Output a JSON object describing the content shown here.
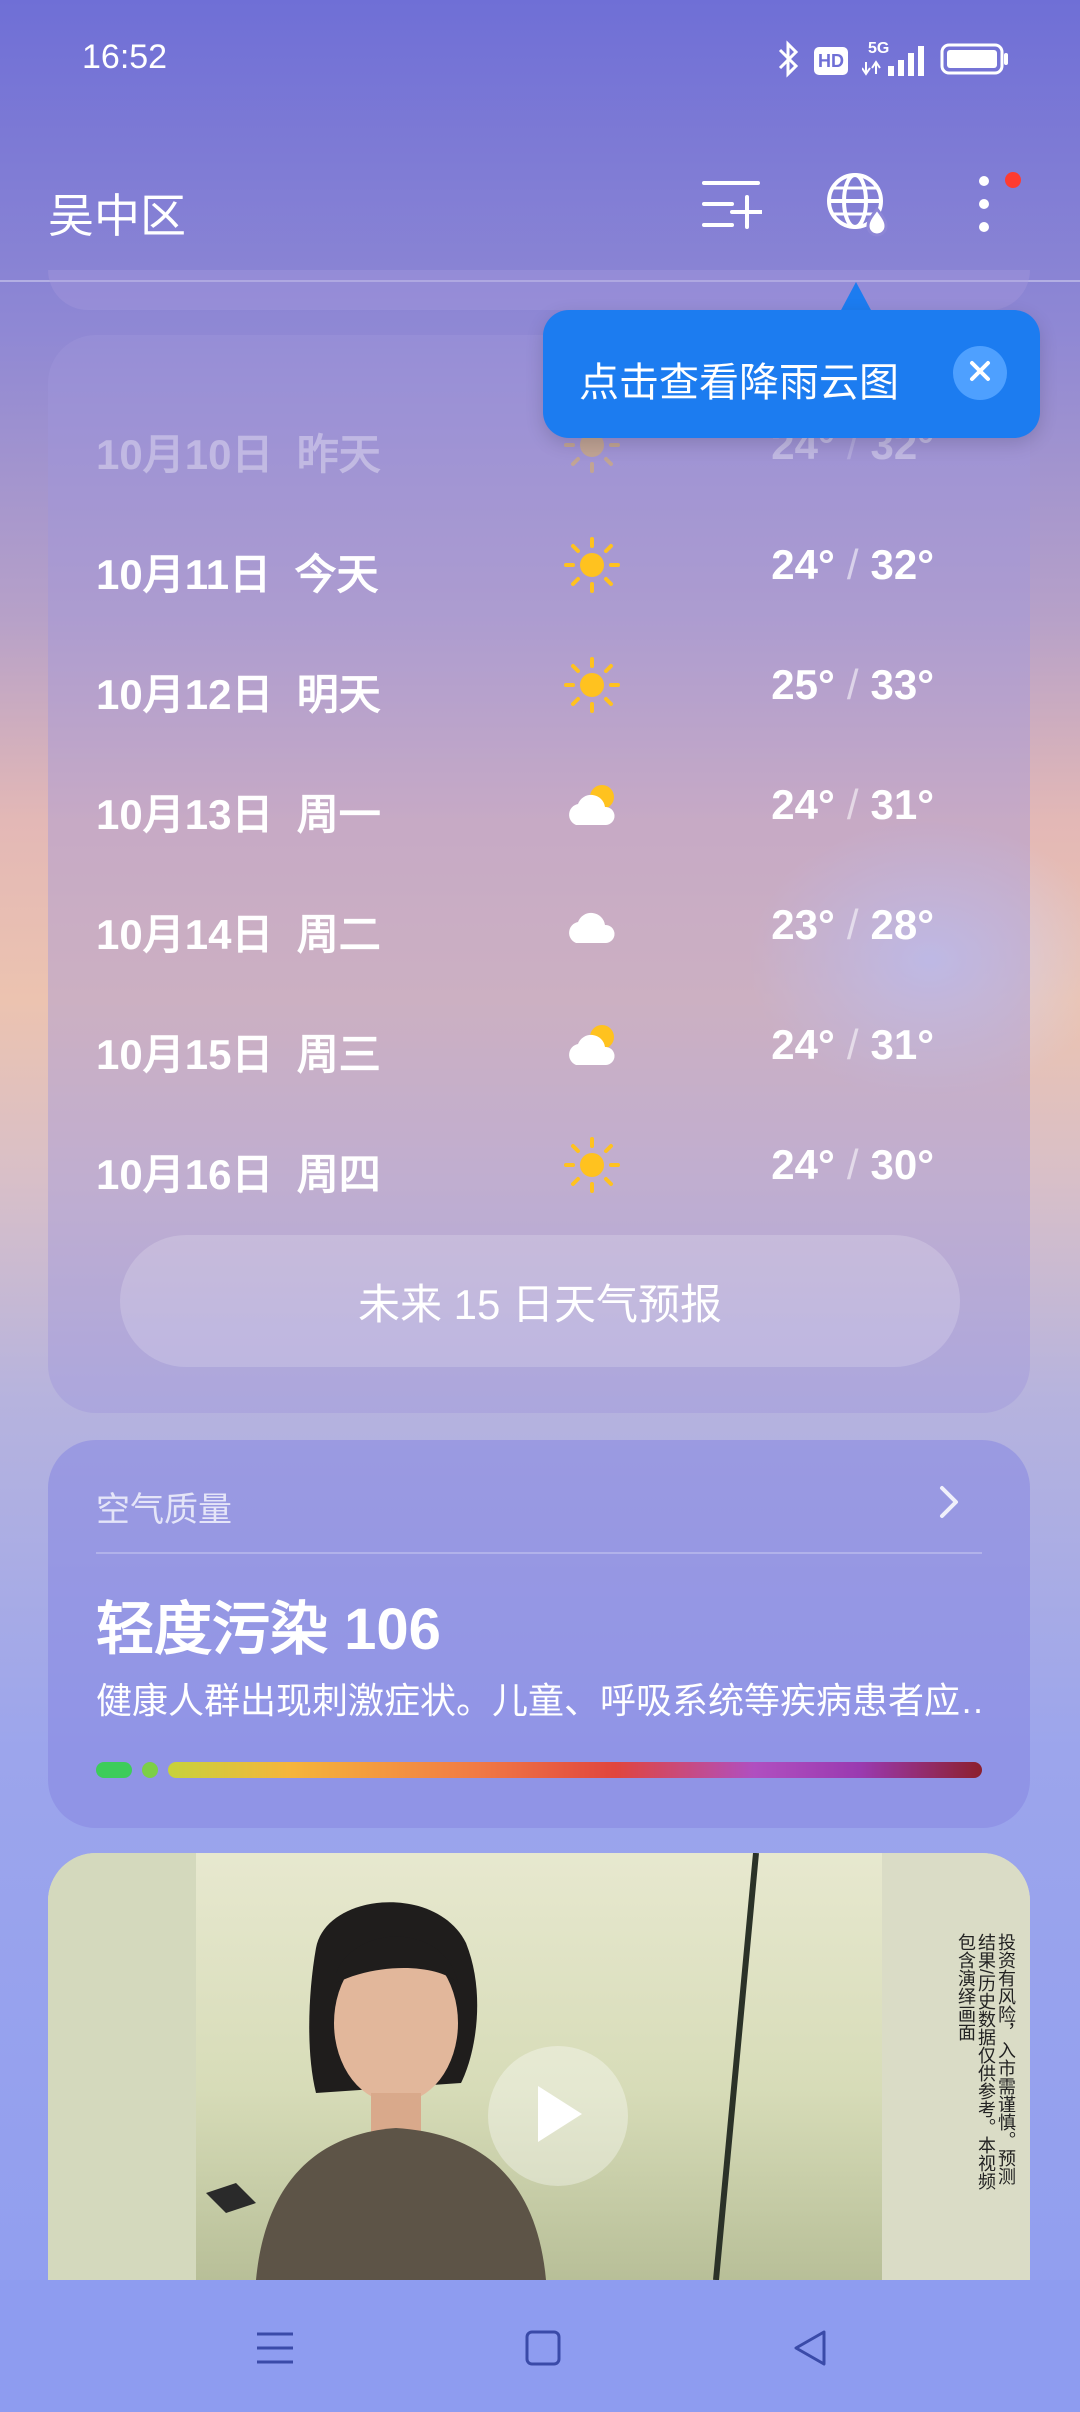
{
  "status_bar": {
    "time": "16:52",
    "icons": [
      "bluetooth-icon",
      "hd-icon",
      "5g-signal-icon",
      "battery-icon"
    ],
    "hd_label": "HD",
    "network_label": "5G"
  },
  "header": {
    "location": "吴中区",
    "actions": [
      "manage-cities-icon",
      "rain-map-icon",
      "more-icon"
    ],
    "notification_dot_color": "#ff3b30"
  },
  "tooltip": {
    "text": "点击查看降雨云图",
    "background_color": "#1c7cf0"
  },
  "forecast": {
    "days": [
      {
        "date": "10月10日",
        "day": "昨天",
        "icon": "sunny-icon",
        "low": "24°",
        "high": "32°"
      },
      {
        "date": "10月11日",
        "day": "今天",
        "icon": "sunny-icon",
        "low": "24°",
        "high": "32°"
      },
      {
        "date": "10月12日",
        "day": "明天",
        "icon": "sunny-icon",
        "low": "25°",
        "high": "33°"
      },
      {
        "date": "10月13日",
        "day": "周一",
        "icon": "partly-cloudy-icon",
        "low": "24°",
        "high": "31°"
      },
      {
        "date": "10月14日",
        "day": "周二",
        "icon": "cloudy-icon",
        "low": "23°",
        "high": "28°"
      },
      {
        "date": "10月15日",
        "day": "周三",
        "icon": "partly-cloudy-icon",
        "low": "24°",
        "high": "31°"
      },
      {
        "date": "10月16日",
        "day": "周四",
        "icon": "sunny-icon",
        "low": "24°",
        "high": "30°"
      }
    ],
    "more_button_label": "未来 15 日天气预报"
  },
  "air_quality": {
    "section_label": "空气质量",
    "level": "轻度污染",
    "aqi": "106",
    "description": "健康人群出现刺激症状。儿童、呼吸系统等疾病患者应…",
    "scale_colors": [
      "#3dcc5a",
      "#7ccf46",
      "#f5b53a",
      "#e0453e",
      "#9a3ab0",
      "#8c1f2e"
    ]
  },
  "video": {
    "disclaimer": "投资有风险，入市需谨慎。预测结果/历史数据仅供参考。本视频包含演绎画面"
  },
  "nav_bar": {
    "buttons": [
      "recents-menu-icon",
      "home-square-icon",
      "back-triangle-icon"
    ]
  },
  "colors": {
    "accent": "#1c7cf0"
  }
}
